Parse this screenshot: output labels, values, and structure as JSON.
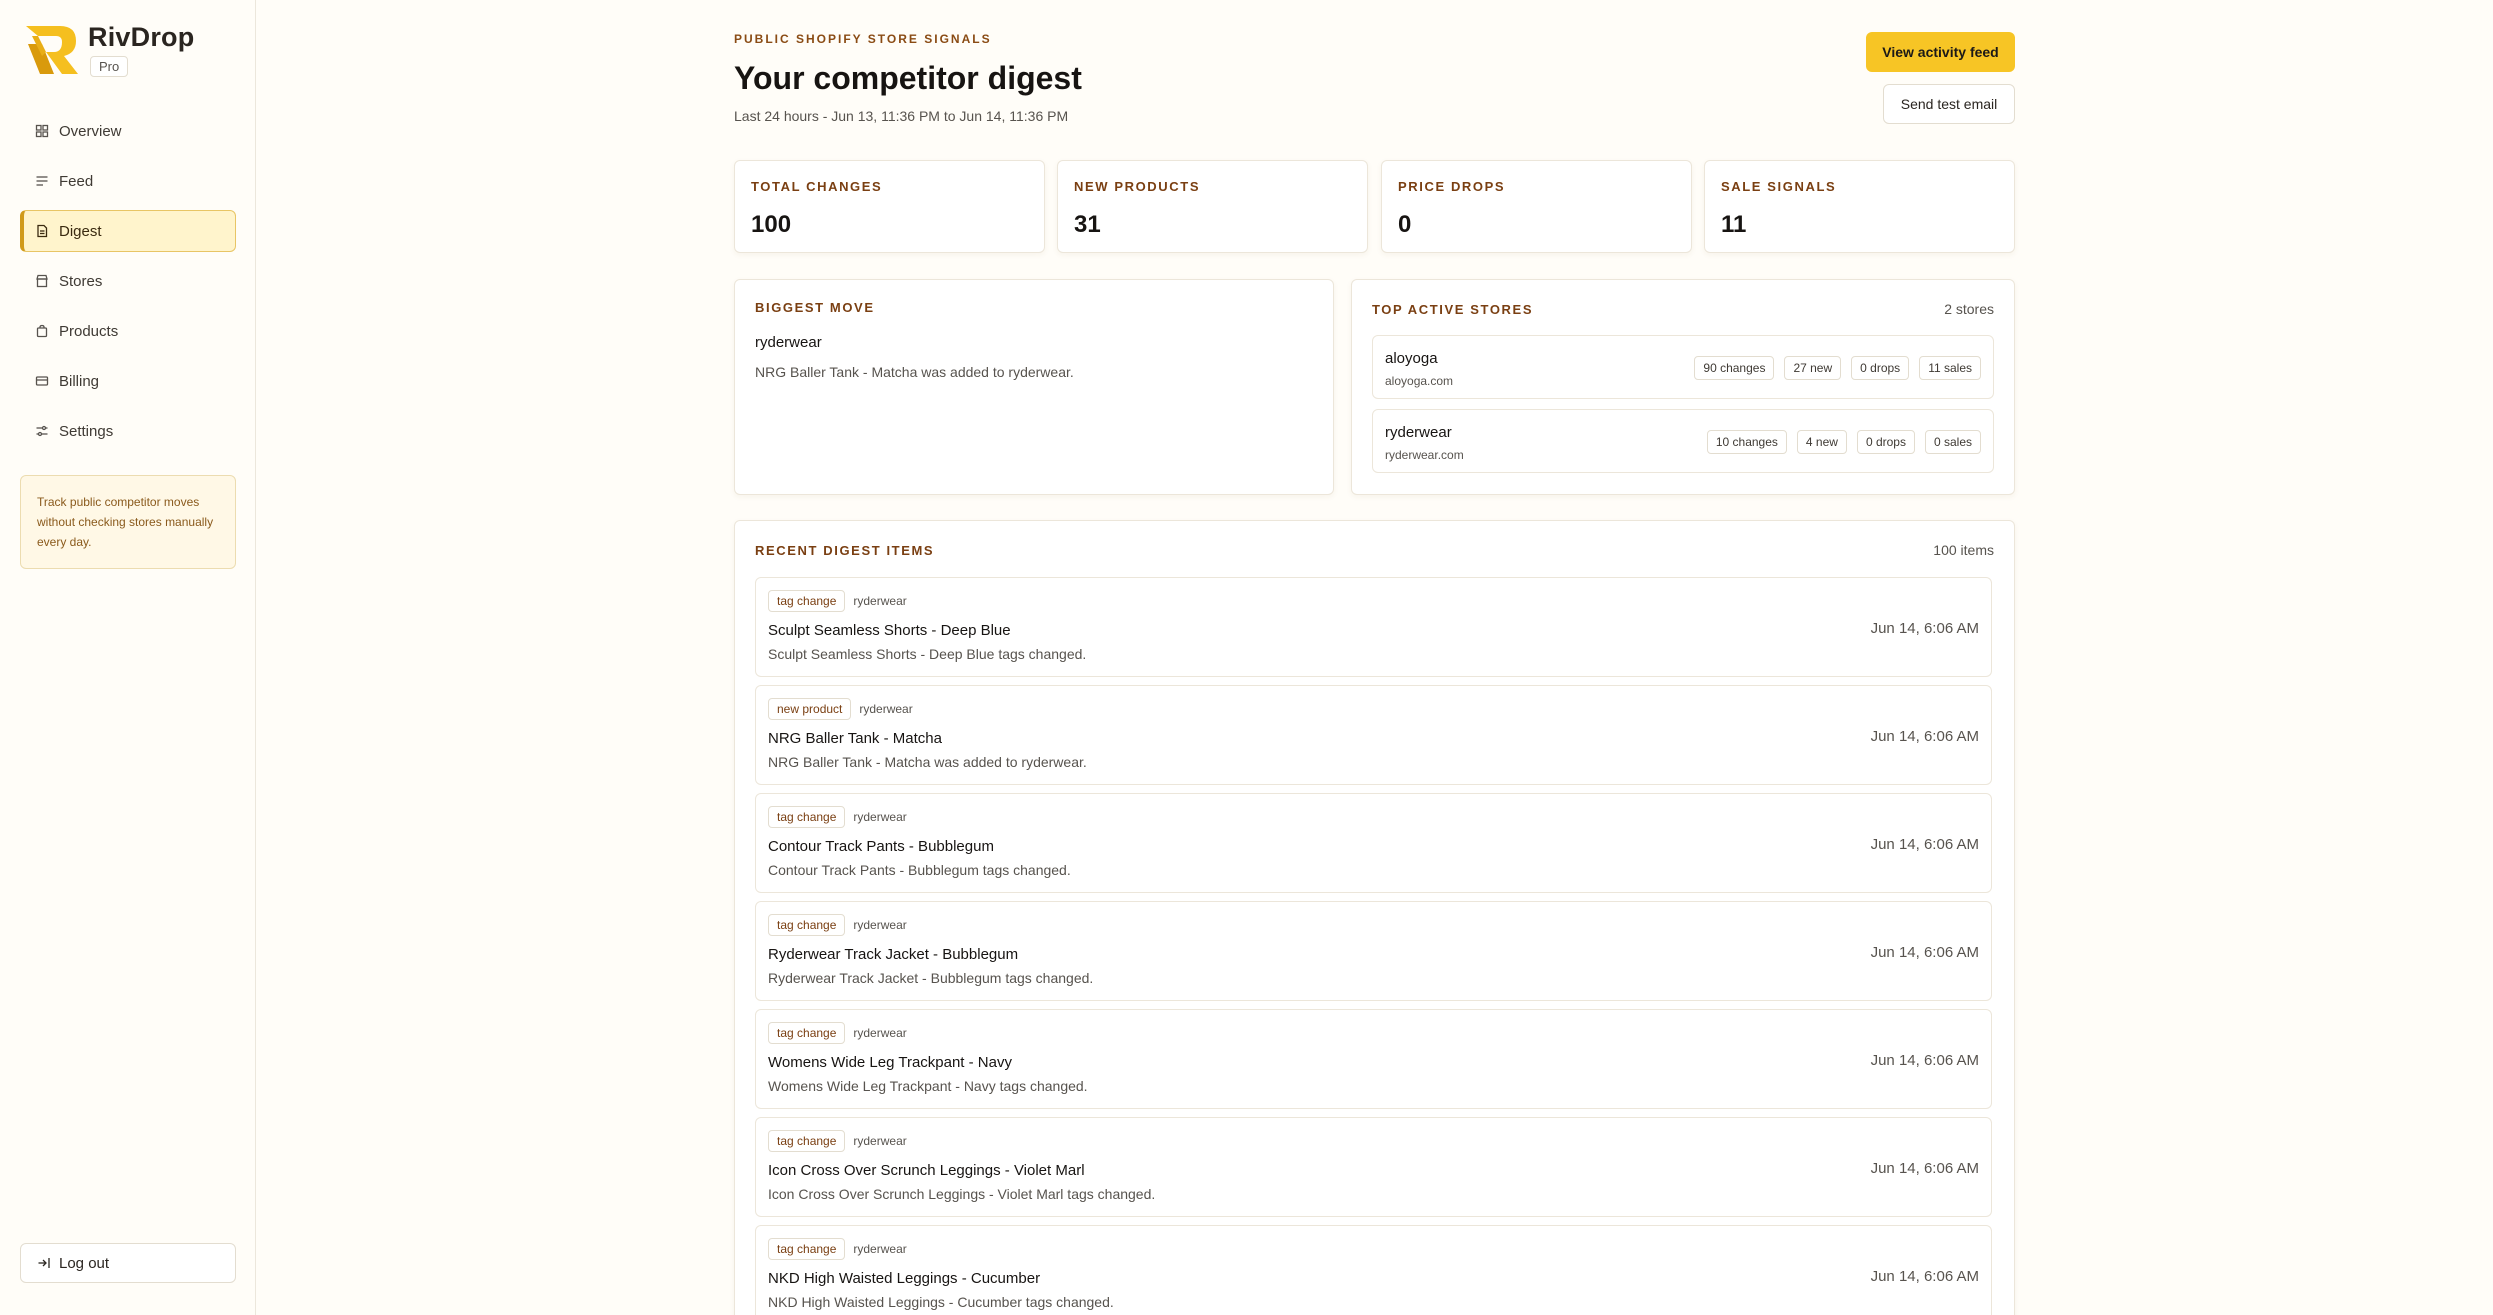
{
  "app": {
    "name": "RivDrop",
    "plan": "Pro"
  },
  "sidebar": {
    "items": [
      {
        "label": "Overview",
        "icon": "grid-icon",
        "active": false
      },
      {
        "label": "Feed",
        "icon": "list-icon",
        "active": false
      },
      {
        "label": "Digest",
        "icon": "document-icon",
        "active": true
      },
      {
        "label": "Stores",
        "icon": "store-icon",
        "active": false
      },
      {
        "label": "Products",
        "icon": "bag-icon",
        "active": false
      },
      {
        "label": "Billing",
        "icon": "card-icon",
        "active": false
      },
      {
        "label": "Settings",
        "icon": "sliders-icon",
        "active": false
      }
    ],
    "tip": "Track public competitor moves without checking stores manually every day.",
    "logout_label": "Log out"
  },
  "header": {
    "eyebrow": "PUBLIC SHOPIFY STORE SIGNALS",
    "title": "Your competitor digest",
    "subtitle": "Last 24 hours - Jun 13, 11:36 PM to Jun 14, 11:36 PM",
    "primary_button": "View activity feed",
    "secondary_button": "Send test email"
  },
  "stats": [
    {
      "label": "TOTAL CHANGES",
      "value": "100"
    },
    {
      "label": "NEW PRODUCTS",
      "value": "31"
    },
    {
      "label": "PRICE DROPS",
      "value": "0"
    },
    {
      "label": "SALE SIGNALS",
      "value": "11"
    }
  ],
  "biggest_move": {
    "label": "BIGGEST MOVE",
    "store": "ryderwear",
    "description": "NRG Baller Tank - Matcha was added to ryderwear."
  },
  "top_stores": {
    "label": "TOP ACTIVE STORES",
    "count": "2 stores",
    "stores": [
      {
        "name": "aloyoga",
        "domain": "aloyoga.com",
        "changes": "90 changes",
        "new": "27 new",
        "drops": "0 drops",
        "sales": "11 sales"
      },
      {
        "name": "ryderwear",
        "domain": "ryderwear.com",
        "changes": "10 changes",
        "new": "4 new",
        "drops": "0 drops",
        "sales": "0 sales"
      }
    ]
  },
  "recent": {
    "label": "RECENT DIGEST ITEMS",
    "count": "100 items",
    "items": [
      {
        "tag": "tag change",
        "store": "ryderwear",
        "title": "Sculpt Seamless Shorts - Deep Blue",
        "description": "Sculpt Seamless Shorts - Deep Blue tags changed.",
        "time": "Jun 14, 6:06 AM"
      },
      {
        "tag": "new product",
        "store": "ryderwear",
        "title": "NRG Baller Tank - Matcha",
        "description": "NRG Baller Tank - Matcha was added to ryderwear.",
        "time": "Jun 14, 6:06 AM"
      },
      {
        "tag": "tag change",
        "store": "ryderwear",
        "title": "Contour Track Pants - Bubblegum",
        "description": "Contour Track Pants - Bubblegum tags changed.",
        "time": "Jun 14, 6:06 AM"
      },
      {
        "tag": "tag change",
        "store": "ryderwear",
        "title": "Ryderwear Track Jacket - Bubblegum",
        "description": "Ryderwear Track Jacket - Bubblegum tags changed.",
        "time": "Jun 14, 6:06 AM"
      },
      {
        "tag": "tag change",
        "store": "ryderwear",
        "title": "Womens Wide Leg Trackpant - Navy",
        "description": "Womens Wide Leg Trackpant - Navy tags changed.",
        "time": "Jun 14, 6:06 AM"
      },
      {
        "tag": "tag change",
        "store": "ryderwear",
        "title": "Icon Cross Over Scrunch Leggings - Violet Marl",
        "description": "Icon Cross Over Scrunch Leggings - Violet Marl tags changed.",
        "time": "Jun 14, 6:06 AM"
      },
      {
        "tag": "tag change",
        "store": "ryderwear",
        "title": "NKD High Waisted Leggings - Cucumber",
        "description": "NKD High Waisted Leggings - Cucumber tags changed.",
        "time": "Jun 14, 6:06 AM"
      }
    ]
  },
  "colors": {
    "accent": "#f7c525",
    "brand_dark": "#7a3f12",
    "active_bg": "#fff4cc"
  }
}
